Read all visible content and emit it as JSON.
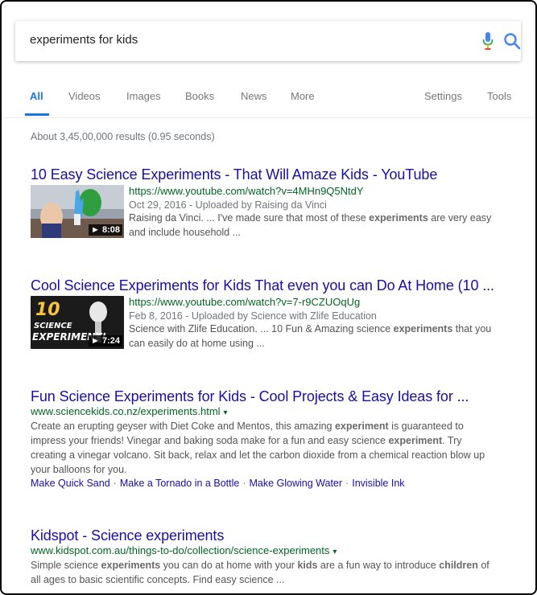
{
  "search": {
    "query": "experiments for kids"
  },
  "tabs": [
    {
      "label": "All"
    },
    {
      "label": "Videos"
    },
    {
      "label": "Images"
    },
    {
      "label": "Books"
    },
    {
      "label": "News"
    },
    {
      "label": "More"
    },
    {
      "label": "Settings"
    },
    {
      "label": "Tools"
    }
  ],
  "stats": "About 3,45,00,000 results (0.95 seconds)",
  "results": [
    {
      "title": "10 Easy Science Experiments - That Will Amaze Kids - YouTube",
      "url": "https://www.youtube.com/watch?v=4MHn9Q5NtdY",
      "meta": "Oct 29, 2016 - Uploaded by Raising da Vinci",
      "snippet_1": "Raising da Vinci. ... I've made sure that most of these ",
      "snippet_bold": "experiments",
      "snippet_2": " are very easy",
      "snippet_3": "and include household ...",
      "duration": "8:08"
    },
    {
      "title": "Cool Science Experiments for Kids That even you can Do At Home (10 ...",
      "url": "https://www.youtube.com/watch?v=7-r9CZUOqUg",
      "meta": "Feb 8, 2016 - Uploaded by Science with Zlife Education",
      "snippet_1": "Science with Zlife Education. ... 10 Fun & Amazing science ",
      "snippet_bold": "experiments",
      "snippet_2": " that you",
      "snippet_3": "can easily do at home using ...",
      "duration": "7:24",
      "thumb_text_1": "10",
      "thumb_text_2": "SCIENCE",
      "thumb_text_3": "EXPERIMENT!"
    },
    {
      "title": "Fun Science Experiments for Kids - Cool Projects & Easy Ideas for ...",
      "url": "www.sciencekids.co.nz/experiments.html",
      "l1a": "Create an erupting geyser with Diet Coke and Mentos, this amazing ",
      "l1b": "experiment",
      "l1c": " is guaranteed to",
      "l2a": "impress your friends! Vinegar and baking soda make for a fun and easy science ",
      "l2b": "experiment",
      "l2c": ". Try",
      "l3": "creating a vinegar volcano. Sit back, relax and let the carbon dioxide from a chemical reaction blow up",
      "l4": "your balloons for you.",
      "sitelinks": [
        "Make Quick Sand",
        "Make a Tornado in a Bottle",
        "Make Glowing Water",
        "Invisible Ink"
      ]
    },
    {
      "title": "Kidspot - Science experiments",
      "url": "www.kidspot.com.au/things-to-do/collection/science-experiments",
      "l1a": "Simple science ",
      "l1b": "experiments",
      "l1c": " you can do at home with your ",
      "l1d": "kids",
      "l1e": " are a fun way to introduce ",
      "l1f": "children",
      "l1g": " of",
      "l2": "all ages to basic scientific concepts. Find easy science ..."
    }
  ],
  "caret": "▾",
  "separator": "·",
  "colors": {
    "link": "#1a0dab",
    "url": "#006621",
    "active_tab": "#1a73e8"
  }
}
